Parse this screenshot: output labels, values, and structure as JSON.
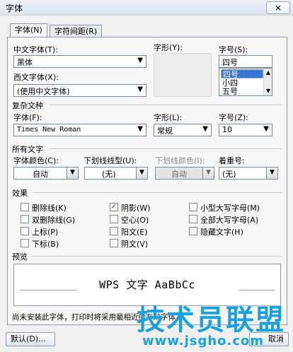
{
  "window": {
    "title": "字体",
    "close_label": "×"
  },
  "tabs": [
    {
      "label": "字体(N)",
      "active": true
    },
    {
      "label": "字符间距(R)",
      "active": false
    }
  ],
  "chinese_font": {
    "label": "中文字体(T):",
    "value": "黑体"
  },
  "font_style": {
    "label": "字形(Y):"
  },
  "font_size": {
    "label": "字号(S):",
    "value": "四号",
    "options": [
      "四号",
      "小四",
      "五号"
    ],
    "selected": "四号"
  },
  "western_font": {
    "label": "西文字体(X):",
    "value": "(使用中文字体)"
  },
  "complex_script": {
    "section": "复杂文种",
    "font_label": "字体(F):",
    "font_value": "Times New Roman",
    "style_label": "字形(L):",
    "style_value": "常规",
    "size_label": "字号(Z):",
    "size_value": "10"
  },
  "all_text": {
    "section": "所有文字",
    "color_label": "字体颜色(C):",
    "color_value": "自动",
    "underline_label": "下划线线型(U):",
    "underline_value": "(无)",
    "underline_color_label": "下划线颜色(I):",
    "underline_color_value": "自动",
    "emphasis_label": "着重号:",
    "emphasis_value": "(无)"
  },
  "effects": {
    "section": "效果",
    "items": [
      {
        "label": "删除线(K)",
        "checked": false
      },
      {
        "label": "双删除线(G)",
        "checked": false
      },
      {
        "label": "上标(P)",
        "checked": false
      },
      {
        "label": "下标(B)",
        "checked": false
      },
      {
        "label": "阴影(W)",
        "checked": true
      },
      {
        "label": "空心(O)",
        "checked": false
      },
      {
        "label": "阳文(E)",
        "checked": false
      },
      {
        "label": "阴文(V)",
        "checked": false
      },
      {
        "label": "小型大写字母(M)",
        "checked": false
      },
      {
        "label": "全部大写字母(A)",
        "checked": false
      },
      {
        "label": "隐藏文字(H)",
        "checked": false
      }
    ]
  },
  "preview": {
    "section": "预览",
    "sample": "WPS 文字 AaBbCc"
  },
  "note": "尚未安装此字体，打印时将采用最相近的有效字体。",
  "buttons": {
    "default_label": "默认(D)...",
    "cancel_label": "取消"
  },
  "watermark": {
    "text": "技术员联盟",
    "url": "www.jsgho.com"
  }
}
